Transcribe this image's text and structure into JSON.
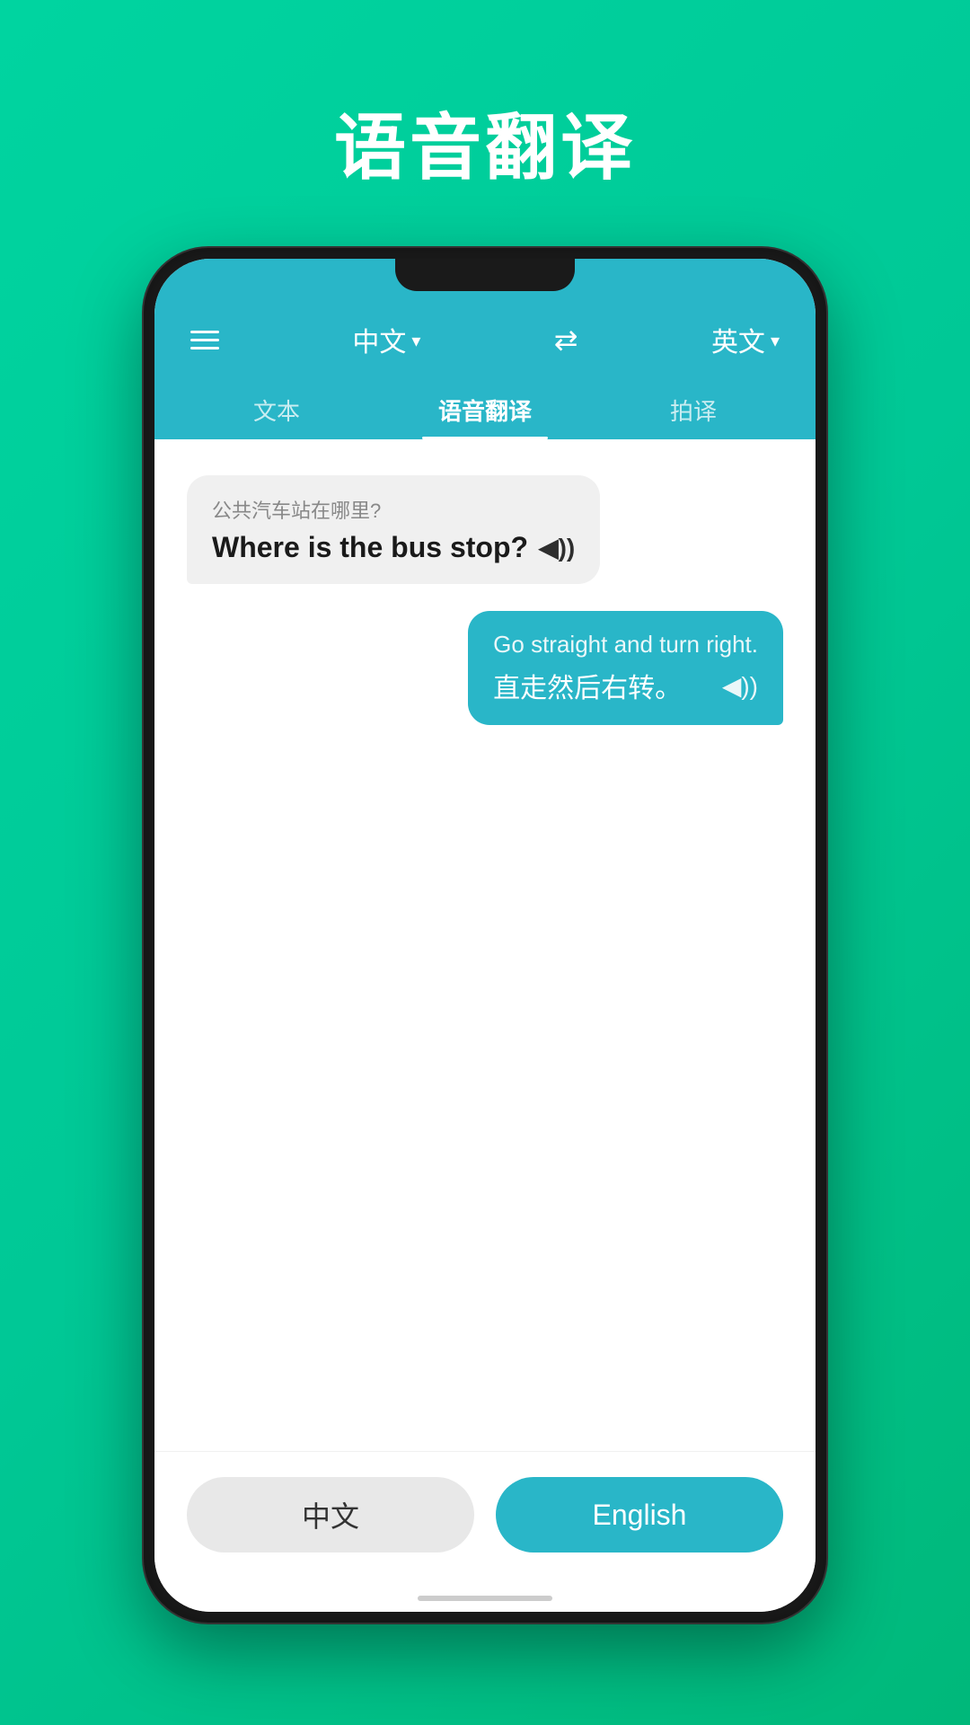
{
  "page": {
    "background_title": "语音翻译",
    "title_color": "#ffffff"
  },
  "header": {
    "menu_label": "menu",
    "source_lang": "中文",
    "source_lang_dropdown": "▾",
    "swap_icon": "⇄",
    "target_lang": "英文",
    "target_lang_dropdown": "▾"
  },
  "tabs": [
    {
      "label": "文本",
      "active": false
    },
    {
      "label": "语音翻译",
      "active": true
    },
    {
      "label": "拍译",
      "active": false
    }
  ],
  "messages": [
    {
      "direction": "left",
      "original": "公共汽车站在哪里?",
      "translated": "Where is the bus stop?",
      "sound": "◀))"
    },
    {
      "direction": "right",
      "original": "Go straight and turn right.",
      "translated": "直走然后右转。",
      "sound": "◀))"
    }
  ],
  "bottom_buttons": {
    "chinese_label": "中文",
    "english_label": "English"
  }
}
